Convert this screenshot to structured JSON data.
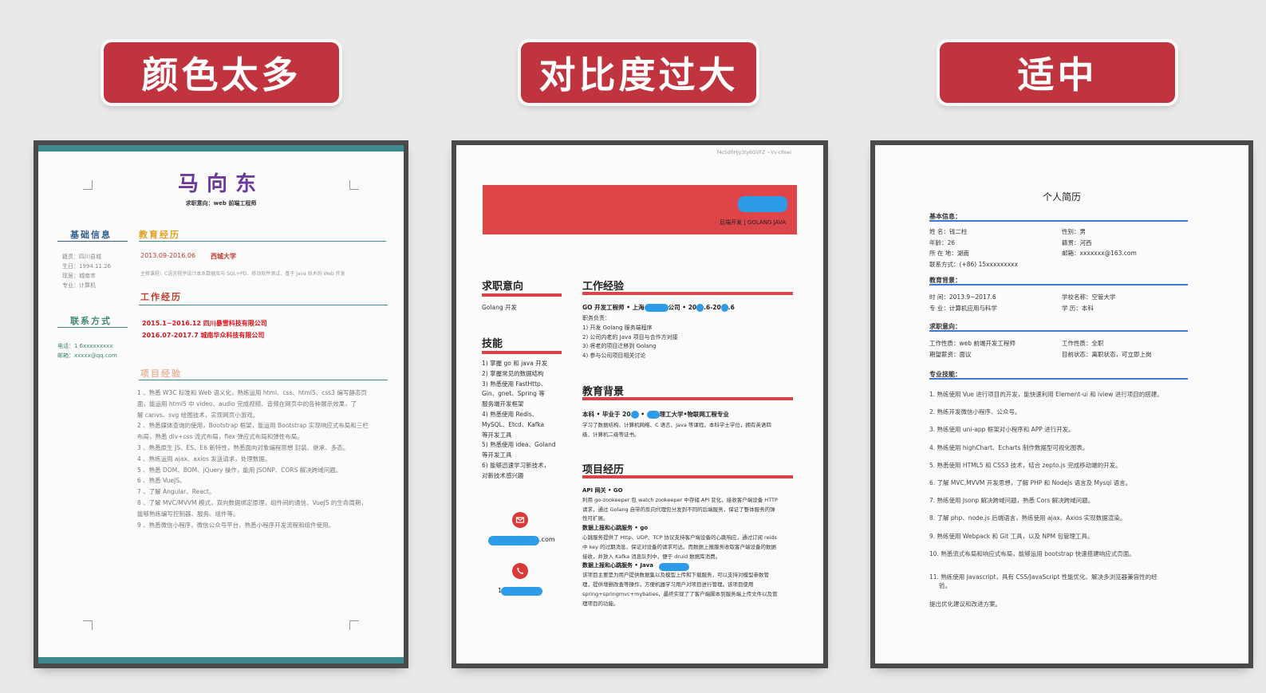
{
  "labels": {
    "left": "颜色太多",
    "middle": "对比度过大",
    "right": "适中"
  },
  "resume1": {
    "name": "马向东",
    "objective": "求职意向：web 前端工程师",
    "basic_title": "基础信息",
    "basic_items": [
      "籍贯：四川县城",
      "生日：1994.11.26",
      "现居：城南市",
      "专业：计算机"
    ],
    "contact_title": "联系方式",
    "contact_items": [
      "电话：1 6xxxxxxxxx",
      "邮箱：xxxxx@qq.com"
    ],
    "edu_title": "教育经历",
    "edu_date": "2013.09-2016.06",
    "edu_school": "西城大学",
    "edu_course": "主修课程：C语言程序设计本系数据库与 SQL+PD、移动软件测试、基于 Java 技术的 Web 开发",
    "work_title": "工作经历",
    "work_items": [
      "2015.1~2016.12  四川暴雪科技有限公司",
      "2016.07-2017.7   城南华众科技有限公司"
    ],
    "proj_title": "项目经验",
    "proj_items": [
      "1 、熟悉 W3C 标准和 Web 语义化，熟练运用 html、css、html5、css3 编写静态页",
      "    面，能运用 html5 中 video、audio 完成视频、音频在网页中的各种展示效果，了",
      "    解 canvs、svg 绘图技术，实现网页小游戏。",
      "2 、熟悉媒体查询的使用，Bootstrap 框架，能运用 Bootstrap 实现响应式布局和三栏",
      "    布局，熟悉 div+css 流式布局，flex 弹应式布局和弹性布局。",
      "3 、熟悉原生 JS、ES、E6 新特性，熟悉面向对象编程思想  封装、继承、多态。",
      "4 、熟练运用 ajax、axios 发送请求，处理数据。",
      "5 、熟悉 DOM、BOM、jQuery 操作，能用 JSONP、CORS 解决跨域问题。",
      "6 、熟悉 VueJS。",
      "7 、了解 Angular、React。",
      "8 、了解 MVC/MVVM 模式，双向数据绑定原理，组件间的通信、VueJS 的生命周期，",
      "    能够熟练编写控制器、服务、组件等。",
      "9 、熟悉微信小程序，微信公众号平台，熟悉小程序开发流程和组件使用。"
    ]
  },
  "resume2": {
    "top_code": "f4c5d0HJy3ty6GVFZ    ~Vv-cReei",
    "banner_tag": "后端开发 | GOLANG JAVA",
    "obj_title": "求职意向",
    "obj_text": "Golang 开发",
    "skills_title": "技能",
    "skills": [
      "1)   掌握 go 和 java 开发",
      "2)   掌握常见的数据结构",
      "3)   熟悉使用 FastHttp、",
      "       Gin、gnet、Spring 等",
      "       服务端开发框架",
      "4)   熟悉使用 Redis、",
      "       MySQL、Etcd、Kafka",
      "       等开发工具",
      "5)   熟悉使用 idea、Goland",
      "       等开发工具",
      "6)   能够迅速学习新技术，",
      "       对新技术感兴趣"
    ],
    "email_suffix": ".com",
    "phone_prefix": "1",
    "work_title": "工作经验",
    "work_head_a": "GO 开发工程师 • 上海",
    "work_head_b": "公司 • 20",
    "work_head_c": ".6-20",
    "work_head_d": ".6",
    "work_items": [
      "职务负责：",
      "1)  开发 Golang 服务端程序",
      "2)  公司内老的 Java 项目与合作方对接",
      "3)  将老的项目迁移到 Golang",
      "4)  参与公司项目相关讨论"
    ],
    "edu_title": "教育背景",
    "edu_head_a": "本科 • 毕业于 20",
    "edu_head_b": "理工大学•物联网工程专业",
    "edu_text": [
      "学习了数据结构、计算机网络、C 语言、Java 等课程。本科学士学位，拥有英语四",
      "级、计算机二级等证书。"
    ],
    "proj_title": "项目经历",
    "proj_lines": [
      {
        "text": "API 网关 • GO",
        "bold": true
      },
      {
        "text": "利用 go-zookeeper 包 watch zookeeper 中存储 API 变化，接收客户端设备 HTTP",
        "bold": false
      },
      {
        "text": "请求，通过 Golang 自带的反向代理包分发到不同的后端服务，保证了整体服务的弹",
        "bold": false
      },
      {
        "text": "性可扩展。",
        "bold": false
      },
      {
        "text": "数据上报和心跳服务 • go",
        "bold": true
      },
      {
        "text": "心跳服务提供了 Http、UDP、TCP 协议支持客户端设备的心跳响应，通过订阅 reids",
        "bold": false
      },
      {
        "text": "中 key 的过期消息，保证对设备的请求可达。而数据上报服务收取客户端设备的数据",
        "bold": false
      },
      {
        "text": "接收，并放入 Kafka 消息队列中，便于 druid 数据库消费。",
        "bold": false
      },
      {
        "text": "数据上报和心跳服务 • Java",
        "bold": true
      },
      {
        "text": "该项目主要是为用户提供数据集以及模型上传和下载服务，可以支持对模型参数管",
        "bold": false
      },
      {
        "text": "理，提供增删改查等操作，方便机器学习用户对项目进行管理。该项目使用",
        "bold": false
      },
      {
        "text": "spring+springmvc+mybaties，最终实现了了客户端脚本到服务端上传文件以及管",
        "bold": false
      },
      {
        "text": "理项目的功能。",
        "bold": false
      }
    ]
  },
  "resume3": {
    "title": "个人简历",
    "basic_title": "基本信息：",
    "basic_left": [
      "姓      名：钱二柱",
      "年龄：26",
      "所 在 地：湖南",
      "联系方式：(+86) 15xxxxxxxxx"
    ],
    "basic_right": [
      "性别：男",
      "",
      "籍贯：河西",
      "邮箱：xxxxxxx@163.com"
    ],
    "edu_title": "教育背景：",
    "edu_left": [
      "时      间：2013.9~2017.6",
      "专      业：计算机应用与科学"
    ],
    "edu_right": [
      "学校名称：空管大学",
      "学      历：本科"
    ],
    "job_title": "求职意向：",
    "job_left": [
      "工作性质：web 前端开发工程师",
      "期望薪资：面议"
    ],
    "job_right": [
      "工作性质：全职",
      "目前状态：离职状态，可立即上岗"
    ],
    "skills_title": "专业技能：",
    "skills": [
      "1. 熟练使用 Vue 进行项目的开发，能快速利用 Element-ui 和 iview 进行项目的搭建。",
      "2. 熟练开发微信小程序、公众号。",
      "3. 熟练使用 uni-app 框架对小程序和 APP 进行开发。",
      "4. 熟练使用 highChart、Echarts 制作数据型可视化图表。",
      "5. 熟悉使用 HTML5 和 CSS3 技术，结合 zepto.js 完成移动端的开发。",
      "6. 了解 MVC,MVVM 开发思想，了解 PHP 和 NodeJs 语言及 Mysql 语言。",
      "7. 熟练使用 Jsonp 解决跨域问题，熟悉 Cors 解决跨域问题。",
      "8. 了解 php、node.js 后端语言，熟练使用 ajax、Axios 实现数据渲染。",
      "9. 熟练使用 Webpack 和 Git 工具，以及 NPM 包管理工具。",
      "10. 熟悉流式布局和响应式布局，能够运用 bootstrap 快速搭建响应式页面。"
    ],
    "skill11_a": "11. 熟练使用 Javascript，具有 CSS/JavaScript 性能优化、解决多浏览器兼容性的经",
    "skill11_b": "验。",
    "closing": "提出优化建议和改进方案。"
  }
}
